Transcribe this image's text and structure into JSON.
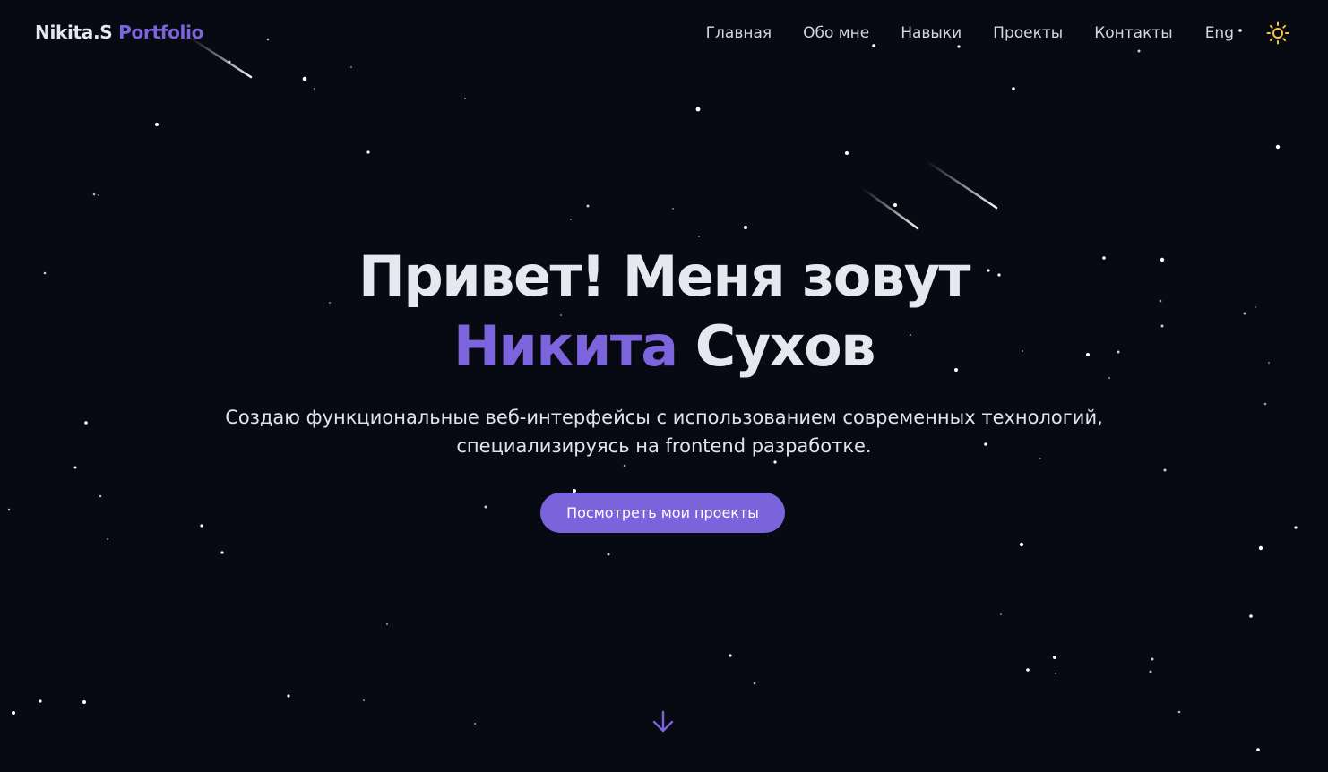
{
  "header": {
    "logo_name": "Nikita.S",
    "logo_accent": "Portfolio",
    "nav": [
      "Главная",
      "Обо мне",
      "Навыки",
      "Проекты",
      "Контакты"
    ],
    "language": "Eng",
    "theme_icon": "sun-icon"
  },
  "hero": {
    "title_line1": "Привет! Меня зовут",
    "first_name": "Никита",
    "last_name": "Сухов",
    "subtitle_line1": "Создаю функциональные веб-интерфейсы с использованием современных технологий,",
    "subtitle_line2": "специализируясь на frontend разработке.",
    "cta_label": "Посмотреть мои проекты",
    "scroll_icon": "arrow-down-icon"
  },
  "colors": {
    "background": "#070a13",
    "accent": "#7c64dc",
    "text": "#e6e8ef",
    "sun": "#f5c542"
  }
}
